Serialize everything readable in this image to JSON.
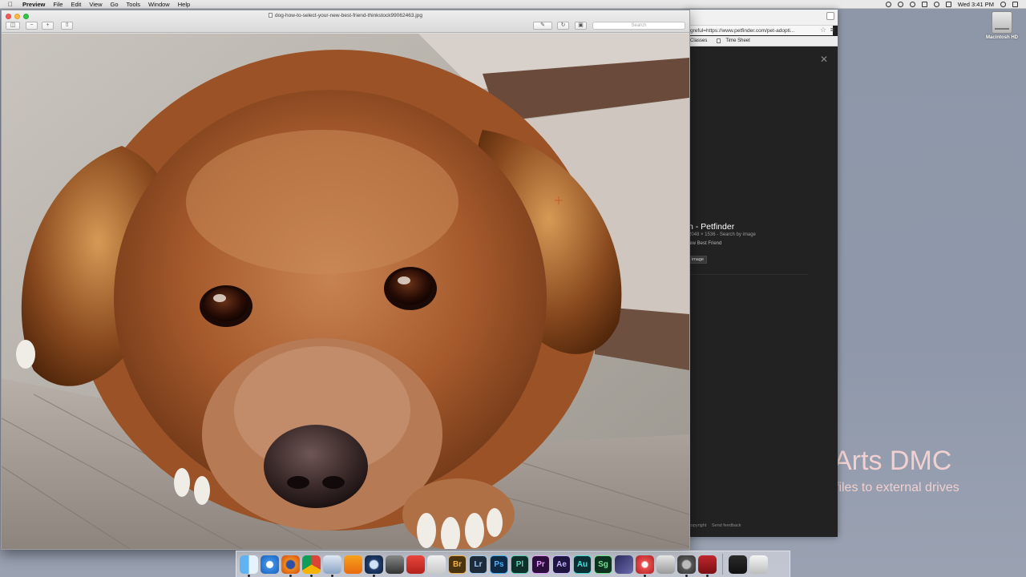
{
  "menubar": {
    "app_name": "Preview",
    "menus": [
      "File",
      "Edit",
      "View",
      "Go",
      "Tools",
      "Window",
      "Help"
    ],
    "clock": "Wed 3:41 PM"
  },
  "desktop": {
    "drive_label": "Macintosh HD",
    "watermark_title": "Arts DMC",
    "watermark_subtitle": "files to external drives"
  },
  "preview": {
    "title": "dog-how-to-select-your-new-best-friend-thinkstock99062463.jpg",
    "search_placeholder": "Search"
  },
  "browser": {
    "address": "greful=https://www.petfinder.com/pet-adopti...",
    "bookmarks": [
      "Classes",
      "Time Sheet"
    ],
    "result_title": "n - Petfinder",
    "result_meta": "2048 × 1536 - Search by image",
    "result_desc": "iew Best Friend",
    "result_button": "image",
    "footer_copyright": "copyright",
    "footer_feedback": "Send feedback"
  },
  "dock": {
    "apps": [
      {
        "name": "finder",
        "label": ""
      },
      {
        "name": "safari",
        "label": ""
      },
      {
        "name": "firefox",
        "label": ""
      },
      {
        "name": "chrome",
        "label": ""
      },
      {
        "name": "preview",
        "label": ""
      },
      {
        "name": "vlc",
        "label": ""
      },
      {
        "name": "quicktime",
        "label": ""
      },
      {
        "name": "utility",
        "label": ""
      },
      {
        "name": "sketchup",
        "label": ""
      },
      {
        "name": "mail-app",
        "label": ""
      },
      {
        "name": "bridge",
        "label": "Br"
      },
      {
        "name": "lightroom",
        "label": "Lr"
      },
      {
        "name": "photoshop",
        "label": "Ps"
      },
      {
        "name": "prelude",
        "label": "Pl"
      },
      {
        "name": "premiere",
        "label": "Pr"
      },
      {
        "name": "after-effects",
        "label": "Ae"
      },
      {
        "name": "audition",
        "label": "Au"
      },
      {
        "name": "speedgrade",
        "label": "Sg"
      },
      {
        "name": "inkscape-like",
        "label": ""
      },
      {
        "name": "davinci",
        "label": ""
      },
      {
        "name": "installer",
        "label": ""
      },
      {
        "name": "system-prefs",
        "label": ""
      },
      {
        "name": "photo-booth",
        "label": ""
      },
      {
        "name": "downloads-folder",
        "label": ""
      },
      {
        "name": "trash",
        "label": ""
      }
    ]
  },
  "colors": {
    "desktop_bg": "#8e97a8",
    "watermark": "#f1d0cf",
    "bridge": "#4a3410",
    "lightroom": "#1d2b3a",
    "photoshop": "#0c2a44",
    "prelude": "#0e2f2a",
    "premiere": "#2c0e3c",
    "after_effects": "#1e1640",
    "audition": "#0b2f33",
    "speedgrade": "#0e3220"
  }
}
